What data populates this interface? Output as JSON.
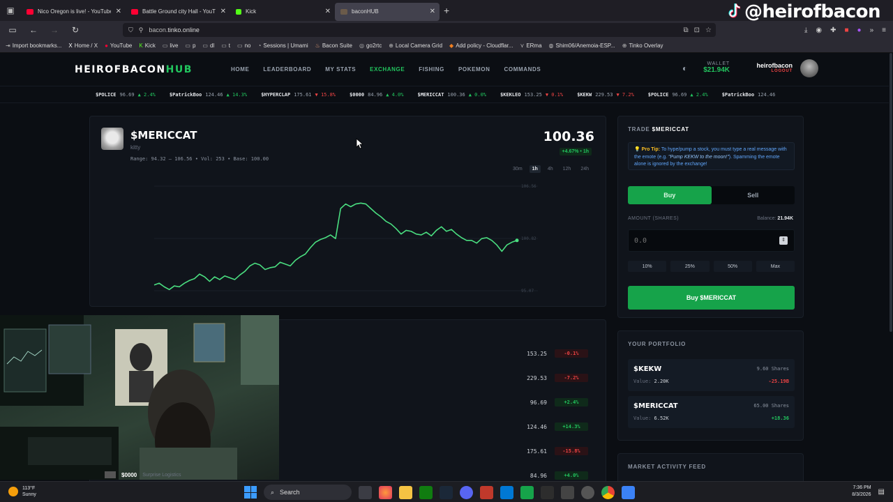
{
  "browser": {
    "tabs": [
      {
        "title": "Nico Oregon is live! - YouTube",
        "color": "#ff0033"
      },
      {
        "title": "Battle Ground city Hall - YouTube",
        "color": "#ff0033"
      },
      {
        "title": "Kick",
        "color": "#53fc18"
      },
      {
        "title": "baconHUB",
        "color": "#6b5b4a"
      }
    ],
    "url_host": "bacon.",
    "url_domain": "tinko.online",
    "bookmarks": [
      "Import bookmarks...",
      "Home / X",
      "YouTube",
      "Kick",
      "live",
      "p",
      "dl",
      "t",
      "no",
      "Sessions | Umami",
      "Bacon Suite",
      "go2rtc",
      "Local Camera Grid",
      "Add policy - Cloudflar...",
      "ERma",
      "Shim06/Anemoia-ESP...",
      "Tinko Overlay"
    ]
  },
  "watermark": "@heirofbacon",
  "site": {
    "logo_main": "HEIROFBACON",
    "logo_hub": "HUB",
    "nav": [
      "HOME",
      "LEADERBOARD",
      "MY STATS",
      "EXCHANGE",
      "FISHING",
      "POKEMON",
      "COMMANDS"
    ],
    "active_nav": "EXCHANGE",
    "wallet_label": "WALLET",
    "wallet_value": "$21.94K",
    "username": "heirofbacon",
    "logout": "LOGOUT"
  },
  "ticker": [
    {
      "sym": "$POLICE",
      "price": "96.69",
      "chg": "▲ 2.4%",
      "dir": "up"
    },
    {
      "sym": "$PatrickBoo",
      "price": "124.46",
      "chg": "▲ 14.3%",
      "dir": "up"
    },
    {
      "sym": "$HYPERCLAP",
      "price": "175.61",
      "chg": "▼ 15.8%",
      "dir": "down"
    },
    {
      "sym": "$0000",
      "price": "84.96",
      "chg": "▲ 4.0%",
      "dir": "up"
    },
    {
      "sym": "$MERICCAT",
      "price": "100.36",
      "chg": "▲ 0.0%",
      "dir": "up"
    },
    {
      "sym": "$KEKLEO",
      "price": "153.25",
      "chg": "▼ 0.1%",
      "dir": "down"
    },
    {
      "sym": "$KEKW",
      "price": "229.53",
      "chg": "▼ 7.2%",
      "dir": "down"
    },
    {
      "sym": "$POLICE",
      "price": "96.69",
      "chg": "▲ 2.4%",
      "dir": "up"
    },
    {
      "sym": "$PatrickBoo",
      "price": "124.46",
      "chg": "",
      "dir": "up"
    }
  ],
  "stock": {
    "name": "$MERICCAT",
    "subtitle": "kitty",
    "stats": "Range: 94.32 – 106.56  •  Vol: 253  •  Base: 100.00",
    "price": "100.36",
    "change": "+4.67% • 1h",
    "timeframes": [
      "30m",
      "1h",
      "4h",
      "12h",
      "24h"
    ],
    "selected_timeframe": "1h"
  },
  "chart_data": {
    "type": "line",
    "title": "",
    "xlabel": "",
    "ylabel": "",
    "ylim": [
      95.07,
      106.56
    ],
    "y_ticks": [
      "106.56",
      "100.82",
      "95.07"
    ],
    "grid": true,
    "series": [
      {
        "values": [
          95.7,
          95.9,
          95.5,
          95.2,
          95.6,
          95.5,
          95.9,
          96.2,
          96.4,
          96.9,
          96.6,
          96.1,
          96.6,
          96.3,
          96.7,
          96.5,
          96.3,
          96.8,
          97.2,
          97.8,
          98.1,
          97.9,
          97.4,
          97.6,
          97.7,
          98.2,
          98.0,
          97.8,
          98.4,
          98.8,
          99.1,
          99.8,
          100.4,
          100.7,
          100.9,
          101.2,
          100.8,
          104.1,
          104.6,
          104.3,
          104.6,
          104.7,
          104.6,
          104.1,
          103.6,
          103.2,
          102.7,
          102.4,
          101.9,
          101.3,
          101.7,
          101.6,
          101.3,
          101.2,
          101.5,
          101.1,
          101.7,
          102.1,
          101.6,
          101.8,
          101.3,
          100.9,
          100.6,
          100.6,
          100.3,
          100.8,
          100.9,
          100.6,
          100.1,
          99.4,
          100.1,
          100.4,
          100.6
        ]
      }
    ]
  },
  "trade": {
    "title_prefix": "TRADE",
    "title_stock": "$MERICCAT",
    "tip_label": "Pro Tip:",
    "tip_text": "To hype/pump a stock, you must type a real message with the emote (e.g.",
    "tip_example": "\"Pump KEKW to the moon!\"",
    "tip_text2": "). Spamming the emote alone is ignored by the exchange!",
    "buy_tab": "Buy",
    "sell_tab": "Sell",
    "amount_label": "AMOUNT (SHARES)",
    "balance_label": "Balance:",
    "balance_value": "21.94K",
    "amount_placeholder": "0.0",
    "pcts": [
      "10%",
      "25%",
      "50%",
      "Max"
    ],
    "buy_button": "Buy $MERICCAT"
  },
  "portfolio": {
    "title": "YOUR PORTFOLIO",
    "positions": [
      {
        "name": "$KEKW",
        "value_label": "Value:",
        "value": "2.20K",
        "shares": "9.60 Shares",
        "delta": "-25.19B",
        "dir": "down"
      },
      {
        "name": "$MERICCAT",
        "value_label": "Value:",
        "value": "6.52K",
        "shares": "65.00 Shares",
        "delta": "+18.36",
        "dir": "up"
      }
    ]
  },
  "feed": {
    "title": "MARKET ACTIVITY FEED"
  },
  "stock_list": [
    {
      "price": "153.25",
      "chg": "-0.1%",
      "dir": "down"
    },
    {
      "price": "229.53",
      "chg": "-7.2%",
      "dir": "down"
    },
    {
      "price": "96.69",
      "chg": "+2.4%",
      "dir": "up"
    },
    {
      "price": "124.46",
      "chg": "+14.3%",
      "dir": "up"
    },
    {
      "price": "175.61",
      "chg": "-15.8%",
      "dir": "down"
    },
    {
      "price": "84.96",
      "chg": "+4.0%",
      "dir": "up"
    }
  ],
  "partial_row": {
    "name": "$0000",
    "sub": "Surprise Logistics"
  },
  "taskbar": {
    "temp": "113°F",
    "weather": "Sunny",
    "search": "Search",
    "time": "7:36 PM",
    "date": "8/3/2026"
  }
}
